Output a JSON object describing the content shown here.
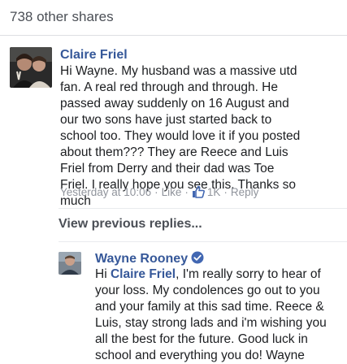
{
  "shares": {
    "label": "738 other shares"
  },
  "comment": {
    "author": "Claire Friel",
    "text": "Hi Wayne.  My husband was a massive utd fan. A real red through and through. He passed away suddenly on 16 August and our two sons have just started back to school too. They would love it if you posted about them??? They are Reece and Luis Friel from Derry and their dad was Toe Friel. I really hope you see this. Thanks so much",
    "timestamp": "Yesterday at 10:06",
    "like_label": "Like",
    "reaction_count": "1K",
    "reply_label": "Reply"
  },
  "view_previous": {
    "label": "View previous replies..."
  },
  "reply": {
    "author": "Wayne Rooney",
    "text_pre": "Hi ",
    "mention": "Claire Friel",
    "text_post": ", I'm really sorry to hear of your loss. My condolences go out to you and your family at this sad time. Reece & Luis, stay strong lads and i'm wishing you all the best for the future. Good luck in school and everything you do! Wayne"
  },
  "colors": {
    "link": "#365899",
    "meta": "#90949c",
    "like_blue": "#4267b2",
    "verified": "#4267b2"
  }
}
